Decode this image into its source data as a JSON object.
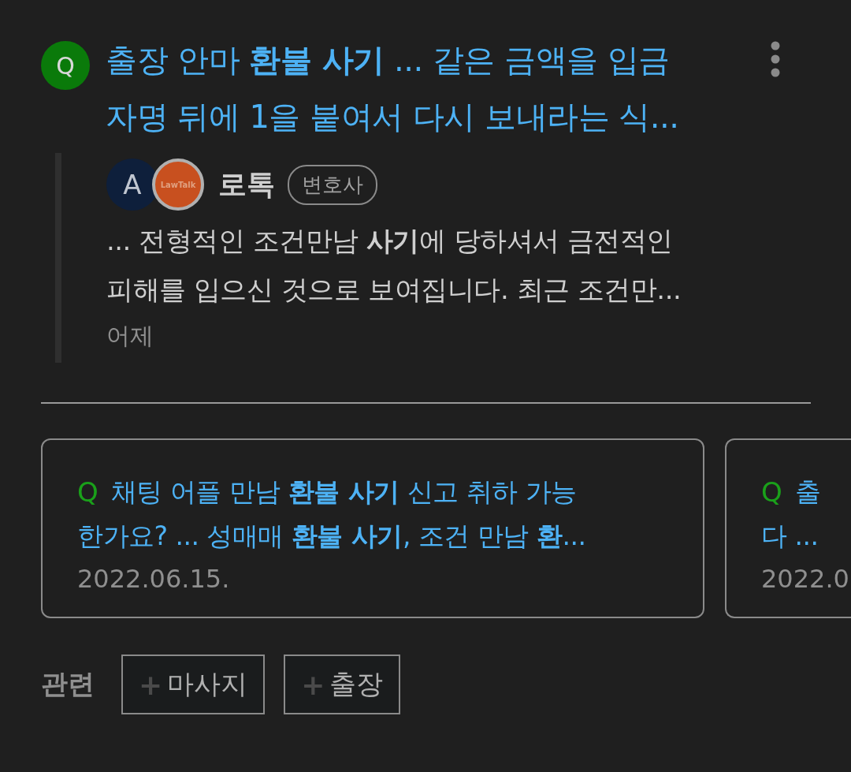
{
  "question": {
    "badge": "Q",
    "title_lines": [
      "출장 안마 **환불 사기** ... 같은 금액을 입금",
      "자명 뒤에 1을 붙여서 다시 보내라는 식..."
    ]
  },
  "answer": {
    "avatar_letter": "A",
    "logo_text": "LawTalk",
    "author": "로톡",
    "role": "변호사",
    "snippet_lines": [
      "... 전형적인 조건만남 **사기**에 당하셔서 금전적인",
      "피해를 입으신 것으로 보여집니다. 최근 조건만..."
    ],
    "time": "어제"
  },
  "related_questions": [
    {
      "badge": "Q",
      "lines": [
        "채팅 어플 만남 **환불 사기** 신고 취하 가능",
        "한가요? ... 성매매 **환불 사기**, 조건 만남 **환**..."
      ],
      "date": "2022.06.15."
    },
    {
      "badge": "Q",
      "lines": [
        "출",
        "다 ..."
      ],
      "date": "2022.0"
    }
  ],
  "related_tags": {
    "label": "관련",
    "tags": [
      {
        "plus": "+",
        "text": "마사지"
      },
      {
        "plus": "+",
        "text": "출장"
      }
    ]
  }
}
